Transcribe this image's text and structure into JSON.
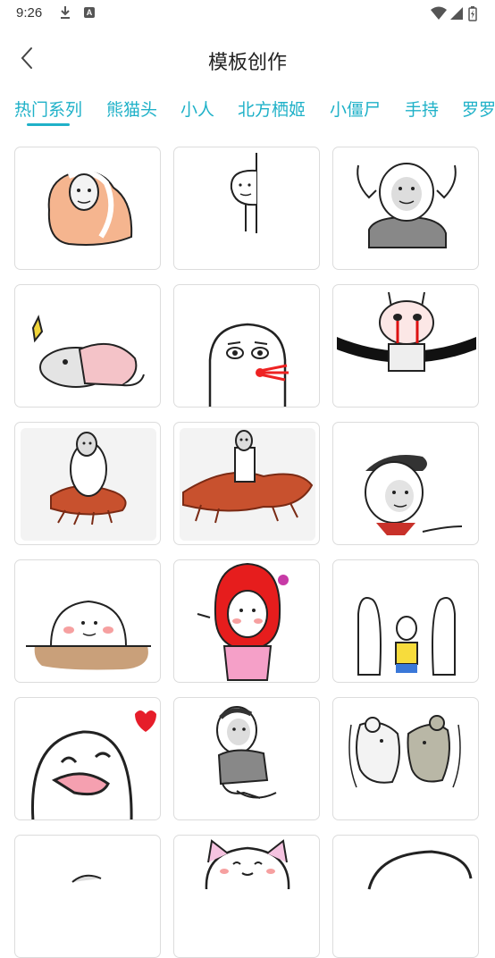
{
  "status_bar": {
    "time": "9:26",
    "a_badge": "A"
  },
  "header": {
    "title": "模板创作"
  },
  "tabs": [
    {
      "label": "热门系列",
      "active": true
    },
    {
      "label": "熊猫头",
      "active": false
    },
    {
      "label": "小人",
      "active": false
    },
    {
      "label": "北方栖姬",
      "active": false
    },
    {
      "label": "小僵尸",
      "active": false
    },
    {
      "label": "手持",
      "active": false
    },
    {
      "label": "罗罗",
      "active": false
    }
  ],
  "colors": {
    "accent": "#1fb1c8",
    "card_border": "#dcdcdc"
  },
  "templates": [
    {
      "icon": "panda-head-blanket"
    },
    {
      "icon": "peeking-stickman"
    },
    {
      "icon": "panda-head-middle-fingers"
    },
    {
      "icon": "hamster-under-blanket"
    },
    {
      "icon": "round-face-spitting"
    },
    {
      "icon": "crying-rabbit-arms-out"
    },
    {
      "icon": "panda-man-riding-shrimp"
    },
    {
      "icon": "panda-man-on-shrimp"
    },
    {
      "icon": "boy-red-scarf-pointing"
    },
    {
      "icon": "blob-face-on-ground"
    },
    {
      "icon": "red-riding-hood-panda"
    },
    {
      "icon": "kid-held-by-two"
    },
    {
      "icon": "heart-laughing-face"
    },
    {
      "icon": "panda-man-sitting"
    },
    {
      "icon": "two-hamsters"
    },
    {
      "icon": "partial-mouse"
    },
    {
      "icon": "cat-ear-face"
    },
    {
      "icon": "partial-ghost"
    }
  ]
}
